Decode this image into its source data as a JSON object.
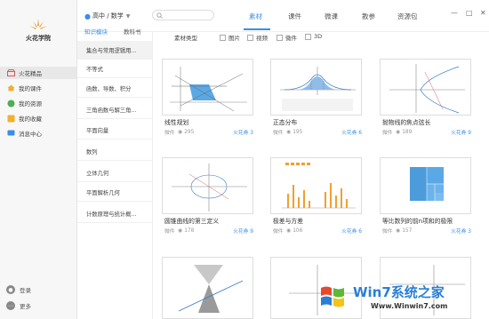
{
  "app": {
    "brand": "火花学院"
  },
  "sidebar": {
    "items": [
      {
        "label": "火花精品",
        "icon": "shop-icon",
        "active": true
      },
      {
        "label": "我的课件",
        "icon": "home-icon"
      },
      {
        "label": "我的资源",
        "icon": "resource-icon"
      },
      {
        "label": "我的收藏",
        "icon": "star-icon"
      },
      {
        "label": "消息中心",
        "icon": "message-icon"
      }
    ],
    "bottom": [
      {
        "label": "登录",
        "icon": "user-icon"
      },
      {
        "label": "更多",
        "icon": "more-icon"
      }
    ]
  },
  "header": {
    "location": "高中 / 数学",
    "search_placeholder": "",
    "tabs": [
      "素材",
      "课件",
      "微课",
      "教参",
      "资源包"
    ],
    "active_tab": "素材"
  },
  "categories": {
    "tabs": [
      "知识模块",
      "教科书"
    ],
    "items": [
      "集合与常用逻辑用...",
      "不等式",
      "函数、导数、积分",
      "三角函数与解三角...",
      "平面向量",
      "数列",
      "立体几何",
      "平面解析几何",
      "计数原理与统计概..."
    ]
  },
  "filter": {
    "label": "素材类型",
    "options": [
      "图片",
      "视频",
      "微件",
      "3D"
    ]
  },
  "cards": [
    {
      "title": "线性规划",
      "type": "微件",
      "views": "295",
      "price": "火花券 3"
    },
    {
      "title": "正态分布",
      "type": "微件",
      "views": "195",
      "price": "火花券 6"
    },
    {
      "title": "抛物线的焦点弦长",
      "type": "微件",
      "views": "189",
      "price": "火花券 9"
    },
    {
      "title": "圆锥曲线的第三定义",
      "type": "微件",
      "views": "178",
      "price": "火花券 9"
    },
    {
      "title": "极差与方差",
      "type": "微件",
      "views": "106",
      "price": "火花券 6"
    },
    {
      "title": "等比数列的前n项和的极限",
      "type": "微件",
      "views": "157",
      "price": "火花券 3"
    }
  ],
  "watermark": {
    "brand": "Win7系统之家",
    "url": "Www.Winwin7.com"
  },
  "colors": {
    "accent": "#3a8ee6",
    "logo": "#e8a33b"
  }
}
